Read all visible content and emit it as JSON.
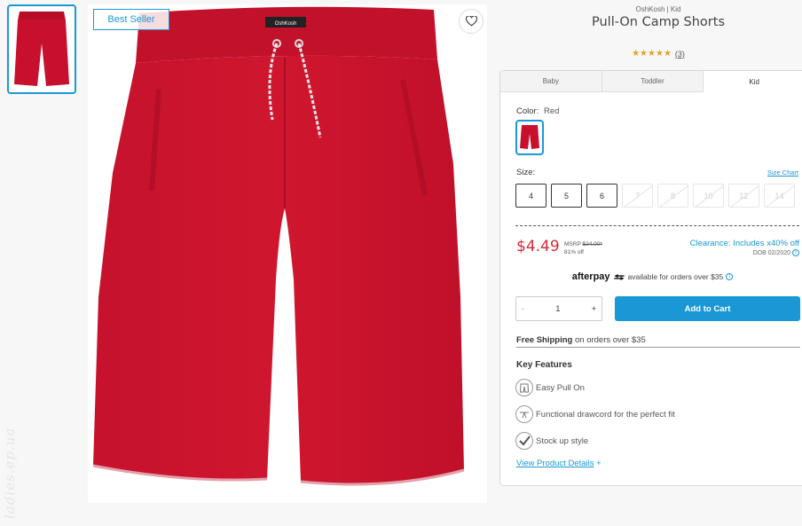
{
  "gallery": {
    "thumbnail_icon": "shorts-thumbnail",
    "badge": "Best Seller",
    "favorite_icon": "heart-outline-icon",
    "watermark": "ladies.ep.ua"
  },
  "product": {
    "brand_line": "OshKosh | Kid",
    "title": "Pull-On Camp Shorts",
    "rating": {
      "stars": "★★★★★",
      "count": "(3)"
    }
  },
  "tabs": [
    {
      "label": "Baby",
      "active": false
    },
    {
      "label": "Toddler",
      "active": false
    },
    {
      "label": "Kid",
      "active": true
    }
  ],
  "color": {
    "label": "Color:",
    "value": "Red",
    "swatch_color": "#c8102e"
  },
  "size": {
    "label": "Size:",
    "chart_link": "Size Chart",
    "options": [
      {
        "label": "4",
        "available": true
      },
      {
        "label": "5",
        "available": true
      },
      {
        "label": "6",
        "available": true
      },
      {
        "label": "7",
        "available": false
      },
      {
        "label": "8",
        "available": false
      },
      {
        "label": "10",
        "available": false
      },
      {
        "label": "12",
        "available": false
      },
      {
        "label": "14",
        "available": false
      }
    ]
  },
  "pricing": {
    "price": "$4.49",
    "msrp_label": "MSRP",
    "msrp_value": "$24.00*",
    "discount": "81% off",
    "clearance": "Clearance: Includes x40% off",
    "dob": "DOB 02/2020"
  },
  "afterpay": {
    "logo": "afterpay",
    "text": "available for orders over $35"
  },
  "cart": {
    "minus": "-",
    "quantity": "1",
    "plus": "+",
    "add_label": "Add to Cart"
  },
  "shipping": {
    "bold": "Free Shipping",
    "rest": "on orders over $35"
  },
  "features": {
    "title": "Key Features",
    "items": [
      {
        "icon": "pants-icon",
        "label": "Easy Pull On"
      },
      {
        "icon": "drawcord-icon",
        "label": "Functional drawcord for the perfect fit"
      },
      {
        "icon": "check-icon",
        "label": "Stock up style"
      }
    ],
    "details_link": "View Product Details",
    "details_plus": "+"
  },
  "colors": {
    "accent": "#1a98d5",
    "price_red": "#d12a3a",
    "product_red": "#c8102e",
    "star": "#e2a520"
  }
}
